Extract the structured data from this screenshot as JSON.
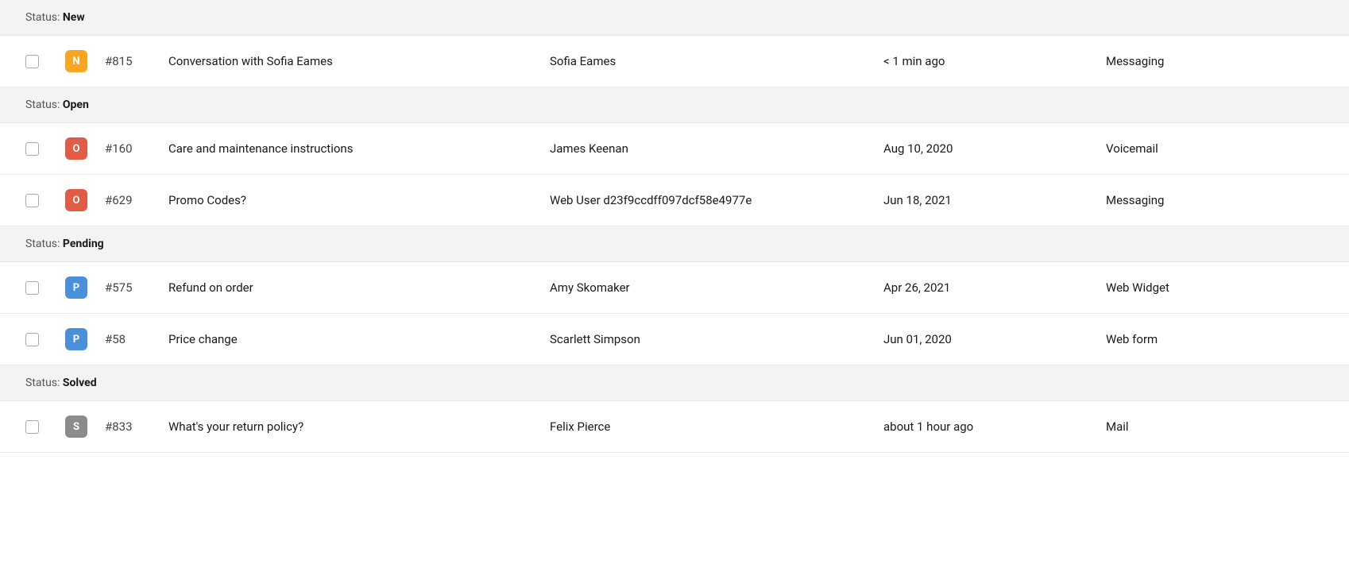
{
  "colors": {
    "badge_new": "#f5a623",
    "badge_open": "#e05c44",
    "badge_pending": "#4a90d9",
    "badge_solved": "#8c8c8c"
  },
  "statusGroups": [
    {
      "label": "Status: ",
      "status": "New",
      "rows": [
        {
          "id": "#815",
          "badge": "N",
          "badgeType": "new",
          "title": "Conversation with Sofia Eames",
          "contact": "Sofia Eames",
          "time": "< 1 min ago",
          "channel": "Messaging"
        }
      ]
    },
    {
      "label": "Status: ",
      "status": "Open",
      "rows": [
        {
          "id": "#160",
          "badge": "O",
          "badgeType": "open",
          "title": "Care and maintenance instructions",
          "contact": "James Keenan",
          "time": "Aug 10, 2020",
          "channel": "Voicemail"
        },
        {
          "id": "#629",
          "badge": "O",
          "badgeType": "open",
          "title": "Promo Codes?",
          "contact": "Web User d23f9ccdff097dcf58e4977e",
          "time": "Jun 18, 2021",
          "channel": "Messaging"
        }
      ]
    },
    {
      "label": "Status: ",
      "status": "Pending",
      "rows": [
        {
          "id": "#575",
          "badge": "P",
          "badgeType": "pending",
          "title": "Refund on order",
          "contact": "Amy Skomaker",
          "time": "Apr 26, 2021",
          "channel": "Web Widget"
        },
        {
          "id": "#58",
          "badge": "P",
          "badgeType": "pending",
          "title": "Price change",
          "contact": "Scarlett Simpson",
          "time": "Jun 01, 2020",
          "channel": "Web form"
        }
      ]
    },
    {
      "label": "Status: ",
      "status": "Solved",
      "rows": [
        {
          "id": "#833",
          "badge": "S",
          "badgeType": "solved",
          "title": "What's your return policy?",
          "contact": "Felix Pierce",
          "time": "about 1 hour ago",
          "channel": "Mail"
        }
      ]
    }
  ]
}
